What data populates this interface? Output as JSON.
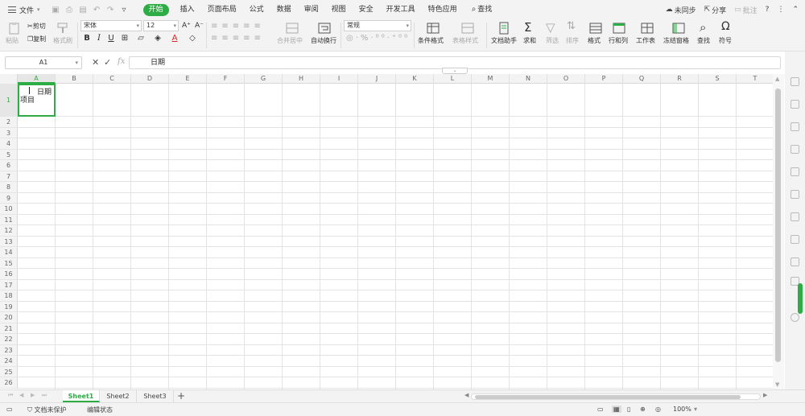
{
  "menubar": {
    "file": "文件",
    "tabs": [
      "开始",
      "插入",
      "页面布局",
      "公式",
      "数据",
      "审阅",
      "视图",
      "安全",
      "开发工具",
      "特色应用"
    ],
    "search": "查找",
    "sync": "未同步",
    "share": "分享",
    "comment": "批注"
  },
  "ribbon": {
    "paste": "粘贴",
    "cut": "剪切",
    "copy": "复制",
    "format_painter": "格式刷",
    "font_name": "宋体",
    "font_size": "12",
    "merge_center": "合并居中",
    "wrap_text": "自动换行",
    "number_format": "常规",
    "conditional_format": "条件格式",
    "table_style": "表格样式",
    "doc_assistant": "文档助手",
    "sum": "求和",
    "filter": "筛选",
    "sort": "排序",
    "format": "格式",
    "row_col": "行和列",
    "worksheet": "工作表",
    "freeze": "冻结窗格",
    "find": "查找",
    "symbol": "符号"
  },
  "formula_bar": {
    "cell_ref": "A1",
    "content": "日期"
  },
  "grid": {
    "columns": [
      "A",
      "B",
      "C",
      "D",
      "E",
      "F",
      "G",
      "H",
      "I",
      "J",
      "K",
      "L",
      "M",
      "N",
      "O",
      "P",
      "Q",
      "R",
      "S",
      "T"
    ],
    "rows": [
      "1",
      "2",
      "3",
      "4",
      "5",
      "6",
      "7",
      "8",
      "9",
      "10",
      "11",
      "12",
      "13",
      "14",
      "15",
      "16",
      "17",
      "18",
      "19",
      "20",
      "21",
      "22",
      "23",
      "24",
      "25",
      "26"
    ],
    "cell_a1_top": "日期",
    "cell_a1_bottom": "项目"
  },
  "sheets": [
    "Sheet1",
    "Sheet2",
    "Sheet3"
  ],
  "statusbar": {
    "protect": "文档未保护",
    "edit_state": "编辑状态",
    "zoom": "100%"
  },
  "colors": {
    "accent": "#2eac45"
  }
}
